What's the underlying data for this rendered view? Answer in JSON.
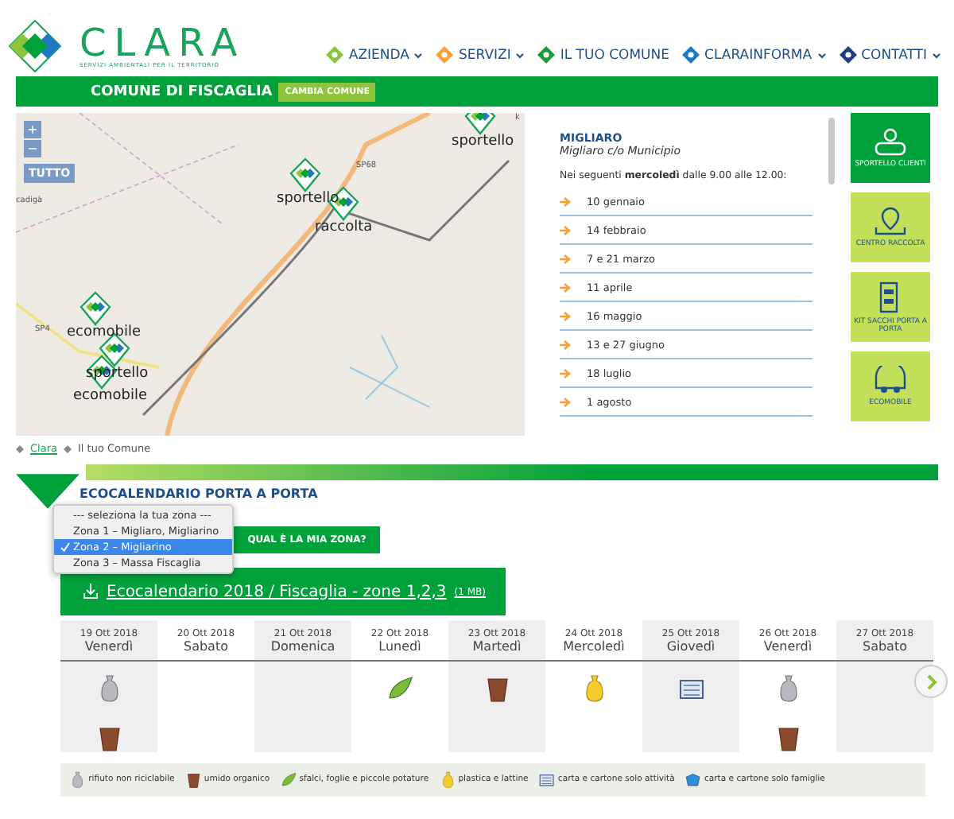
{
  "header": {
    "logo": {
      "name": "CLARA",
      "tagline": "SERVIZI AMBIENTALI PER IL TERRITORIO"
    },
    "nav": [
      {
        "label": "AZIENDA",
        "color": "#8cc43c",
        "has_menu": true
      },
      {
        "label": "SERVIZI",
        "color": "#f7a13a",
        "has_menu": true
      },
      {
        "label": "IL TUO COMUNE",
        "color": "#1f9a3a",
        "has_menu": false
      },
      {
        "label": "CLARAINFORMA",
        "color": "#1f78c1",
        "has_menu": true
      },
      {
        "label": "CONTATTI",
        "color": "#1d3f7a",
        "has_menu": true
      }
    ]
  },
  "municipality_bar": {
    "title": "COMUNE DI FISCAGLIA",
    "button": "CAMBIA COMUNE"
  },
  "map": {
    "zoom_in": "+",
    "zoom_out": "−",
    "all_button": "TUTTO",
    "place_labels": [
      "k",
      "SP68",
      "cadigà",
      "SP4"
    ],
    "markers": [
      "sportello",
      "sportello",
      "raccolta",
      "ecomobile",
      "sportello",
      "ecomobile"
    ]
  },
  "info_panel": {
    "place": "MIGLIARO",
    "location": "Migliaro c/o Municipio",
    "intro": "Nei seguenti **mercoledì** dalle 9.00 alle 12.00:",
    "dates": [
      "10 gennaio",
      "14 febbraio",
      "7 e 21 marzo",
      "11 aprile",
      "16 maggio",
      "13 e 27 giugno",
      "18 luglio",
      "1 agosto"
    ]
  },
  "side_buttons": [
    {
      "label": "SPORTELLO CLIENTI",
      "kind": "people",
      "selected": true
    },
    {
      "label": "CENTRO RACCOLTA",
      "kind": "pin",
      "selected": false
    },
    {
      "label": "KIT SACCHI PORTA A PORTA",
      "kind": "kit",
      "selected": false
    },
    {
      "label": "ECOMOBILE",
      "kind": "van",
      "selected": false
    }
  ],
  "breadcrumb": [
    {
      "label": "Clara",
      "link": true
    },
    {
      "label": "Il tuo Comune",
      "link": false
    }
  ],
  "ecocalendar": {
    "title": "ECOCALENDARIO PORTA A PORTA",
    "zone_options": [
      {
        "label": "--- seleziona la tua zona ---",
        "selected": false
      },
      {
        "label": "Zona 1 – Migliaro, Migliarino",
        "selected": false
      },
      {
        "label": "Zona 2 – Migliarino",
        "selected": true
      },
      {
        "label": "Zona 3 – Massa Fiscaglia",
        "selected": false
      }
    ],
    "zone_help_button": "QUAL È LA MIA ZONA?",
    "download": {
      "label": "Ecocalendario 2018 / Fiscaglia - zone 1,2,3",
      "size": "(1 MB)"
    },
    "days": [
      {
        "date": "19 Ott 2018",
        "weekday": "Venerdì",
        "items": [
          {
            "kind": "residual"
          },
          {
            "kind": "organic"
          }
        ]
      },
      {
        "date": "20 Ott 2018",
        "weekday": "Sabato"
      },
      {
        "date": "21 Ott 2018",
        "weekday": "Domenica"
      },
      {
        "date": "22 Ott 2018",
        "weekday": "Lunedì",
        "items": [
          {
            "kind": "green"
          }
        ]
      },
      {
        "date": "23 Ott 2018",
        "weekday": "Martedì",
        "items": [
          {
            "kind": "organic"
          }
        ]
      },
      {
        "date": "24 Ott 2018",
        "weekday": "Mercoledì",
        "items": [
          {
            "kind": "plastic"
          }
        ]
      },
      {
        "date": "25 Ott 2018",
        "weekday": "Giovedì",
        "items": [
          {
            "kind": "paper_business"
          }
        ]
      },
      {
        "date": "26 Ott 2018",
        "weekday": "Venerdì",
        "items": [
          {
            "kind": "residual"
          },
          {
            "kind": "organic"
          }
        ]
      },
      {
        "date": "27 Ott 2018",
        "weekday": "Sabato"
      }
    ],
    "legend": [
      {
        "kind": "residual",
        "label": "rifiuto non riciclabile"
      },
      {
        "kind": "organic",
        "label": "umido organico"
      },
      {
        "kind": "green",
        "label": "sfalci, foglie e piccole potature"
      },
      {
        "kind": "plastic",
        "label": "plastica e lattine"
      },
      {
        "kind": "paper_business",
        "label": "carta e cartone solo attività"
      },
      {
        "kind": "paper_family",
        "label": "carta e cartone solo famiglie"
      }
    ]
  }
}
